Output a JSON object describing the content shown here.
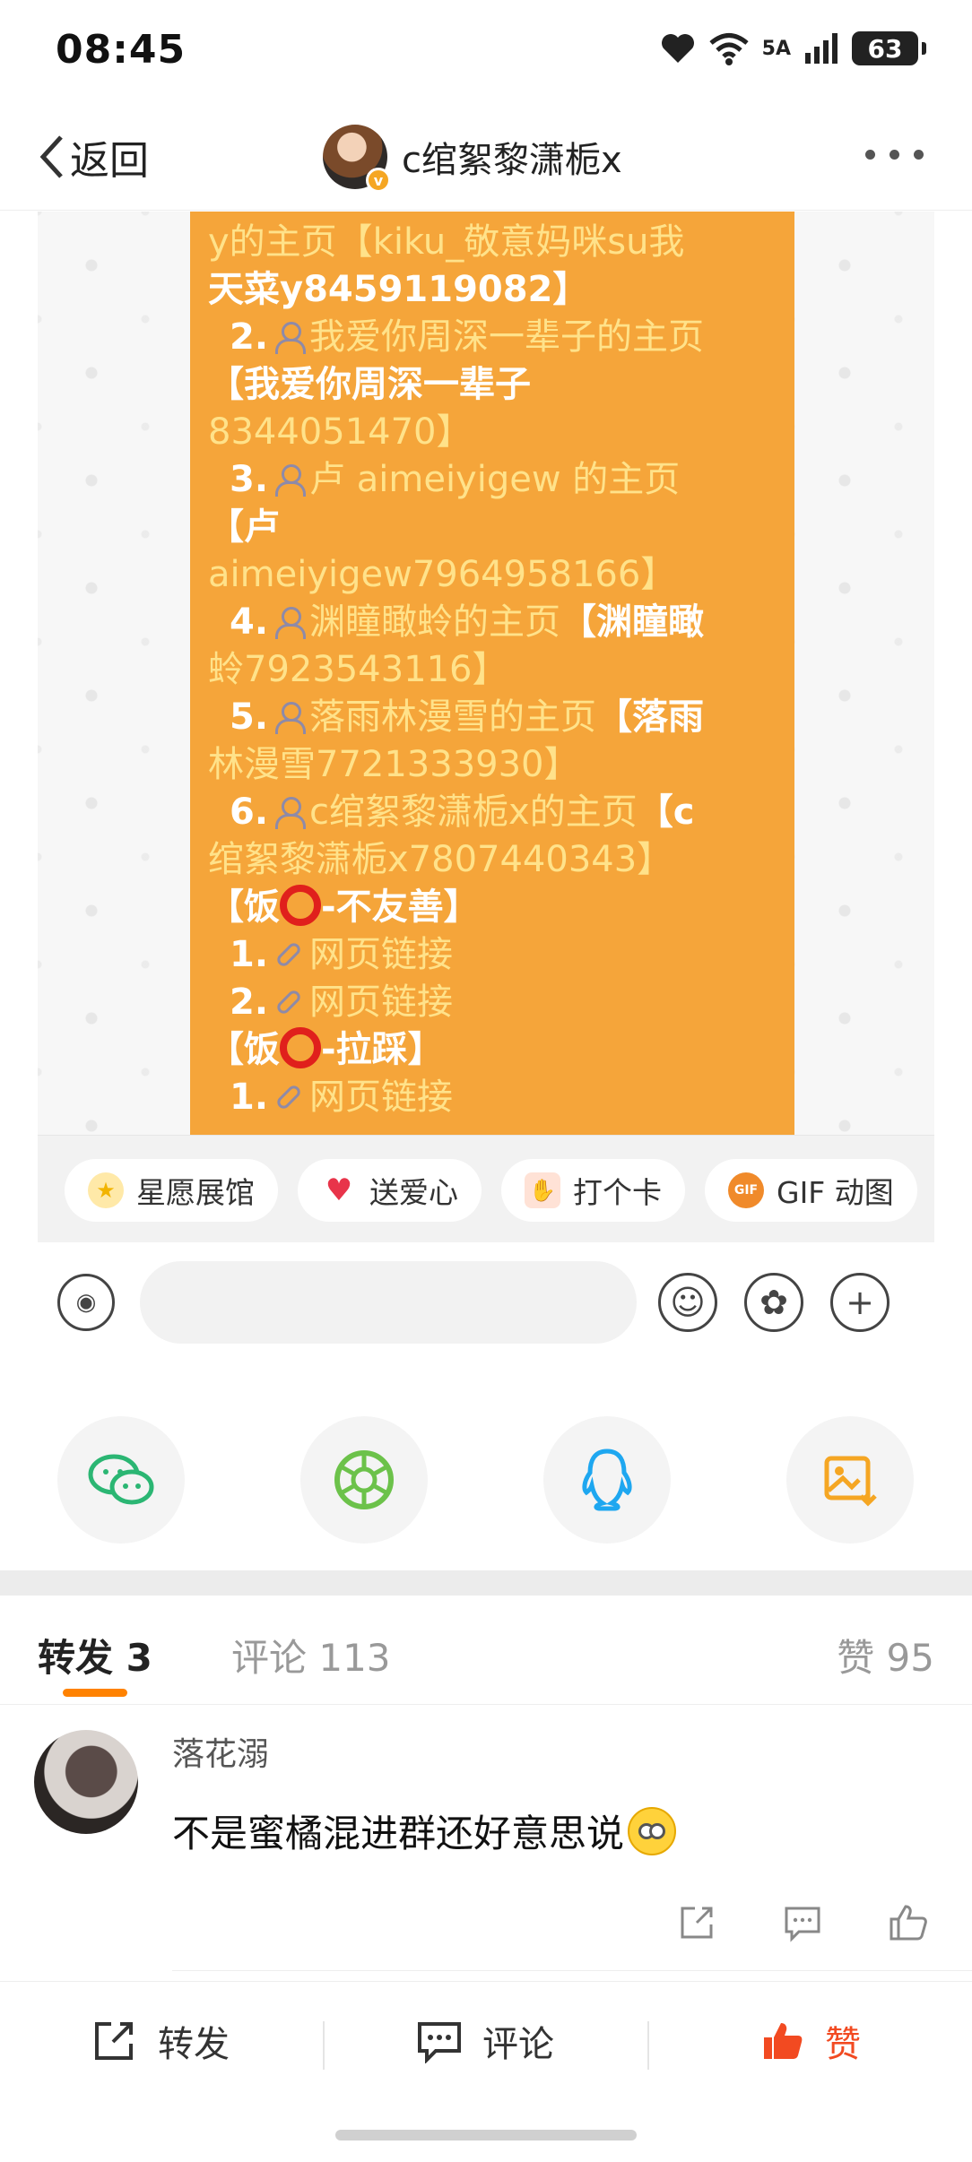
{
  "status_bar": {
    "time": "08:45",
    "network_label": "5A",
    "battery": "63"
  },
  "nav": {
    "back_label": "返回",
    "title": "c绾絮黎潇栀x"
  },
  "post_image": {
    "lines": [
      {
        "kind": "plain",
        "text": "y的主页【kiku_敬意妈咪su我"
      },
      {
        "kind": "plain",
        "text": "天菜y8459119082】"
      },
      {
        "kind": "item",
        "num": "2.",
        "link": "我爱你周深一辈子的主页"
      },
      {
        "kind": "plain",
        "text": "【我爱你周深一辈子"
      },
      {
        "kind": "plain",
        "text": "8344051470】"
      },
      {
        "kind": "item",
        "num": "3.",
        "link": "卢 aimeiyigew 的主页"
      },
      {
        "kind": "plain",
        "text": "【卢"
      },
      {
        "kind": "plain",
        "text": "aimeiyigew7964958166】"
      },
      {
        "kind": "item",
        "num": "4.",
        "link": "渊瞳瞰蛉的主页",
        "tail": "【渊瞳瞰"
      },
      {
        "kind": "plain",
        "text": "蛉7923543116】"
      },
      {
        "kind": "item",
        "num": "5.",
        "link": "落雨林漫雪的主页",
        "tail": "【落雨"
      },
      {
        "kind": "plain",
        "text": "林漫雪7721333930】"
      },
      {
        "kind": "item",
        "num": "6.",
        "link": "c绾絮黎潇栀x的主页",
        "tail": "【c"
      },
      {
        "kind": "plain",
        "text": "绾絮黎潇栀x7807440343】"
      },
      {
        "kind": "section",
        "pre": "【饭",
        "post": "-不友善】"
      },
      {
        "kind": "weblink",
        "num": "1.",
        "link": "网页链接"
      },
      {
        "kind": "weblink",
        "num": "2.",
        "link": "网页链接"
      },
      {
        "kind": "section",
        "pre": "【饭",
        "post": "-拉踩】"
      },
      {
        "kind": "weblink",
        "num": "1.",
        "link": "网页链接"
      }
    ],
    "chips": [
      {
        "label": "星愿展馆",
        "icon": "star-icon"
      },
      {
        "label": "送爱心",
        "icon": "heart-icon"
      },
      {
        "label": "打个卡",
        "icon": "checkin-icon"
      },
      {
        "label": "GIF 动图",
        "icon": "gif-icon"
      }
    ]
  },
  "share_icons": [
    "wechat-icon",
    "moments-icon",
    "qq-icon",
    "save-image-icon"
  ],
  "tabs": {
    "forward": "转发 3",
    "comment": "评论 113",
    "like": "赞 95"
  },
  "comment": {
    "user": "落花溺",
    "text": "不是蜜橘混进群还好意思说"
  },
  "bottom_bar": {
    "forward": "转发",
    "comment": "评论",
    "like": "赞"
  },
  "colors": {
    "accent": "#ff8200",
    "image_bg": "#f5a53a",
    "like_red": "#f24a21"
  }
}
